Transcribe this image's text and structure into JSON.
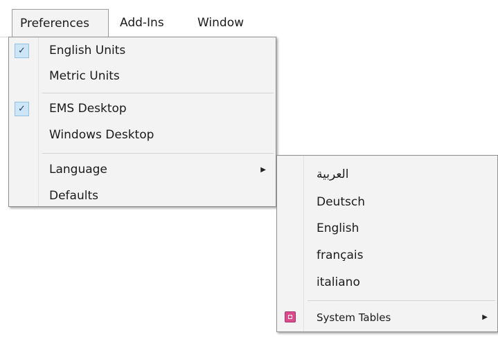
{
  "menubar": {
    "items": [
      "Preferences",
      "Add-Ins",
      "Window"
    ]
  },
  "preferences_menu": {
    "items": [
      {
        "label": "English Units",
        "checked": true
      },
      {
        "label": "Metric Units",
        "checked": false
      },
      {
        "label": "EMS Desktop",
        "checked": true
      },
      {
        "label": "Windows Desktop",
        "checked": false
      },
      {
        "label": "Language",
        "has_submenu": true
      },
      {
        "label": "Defaults"
      }
    ],
    "check_glyph": "✓",
    "submenu_arrow": "▶"
  },
  "language_submenu": {
    "items": [
      {
        "label": "العربية"
      },
      {
        "label": "Deutsch"
      },
      {
        "label": "English"
      },
      {
        "label": "français"
      },
      {
        "label": "italiano"
      },
      {
        "label": "System Tables",
        "icon": "system-tables-icon",
        "has_submenu": true
      }
    ],
    "submenu_arrow": "▶"
  },
  "colors": {
    "menu_background": "#f3f3f3",
    "check_background": "#cde6f7",
    "system_tables_icon": "#d94b8a"
  }
}
